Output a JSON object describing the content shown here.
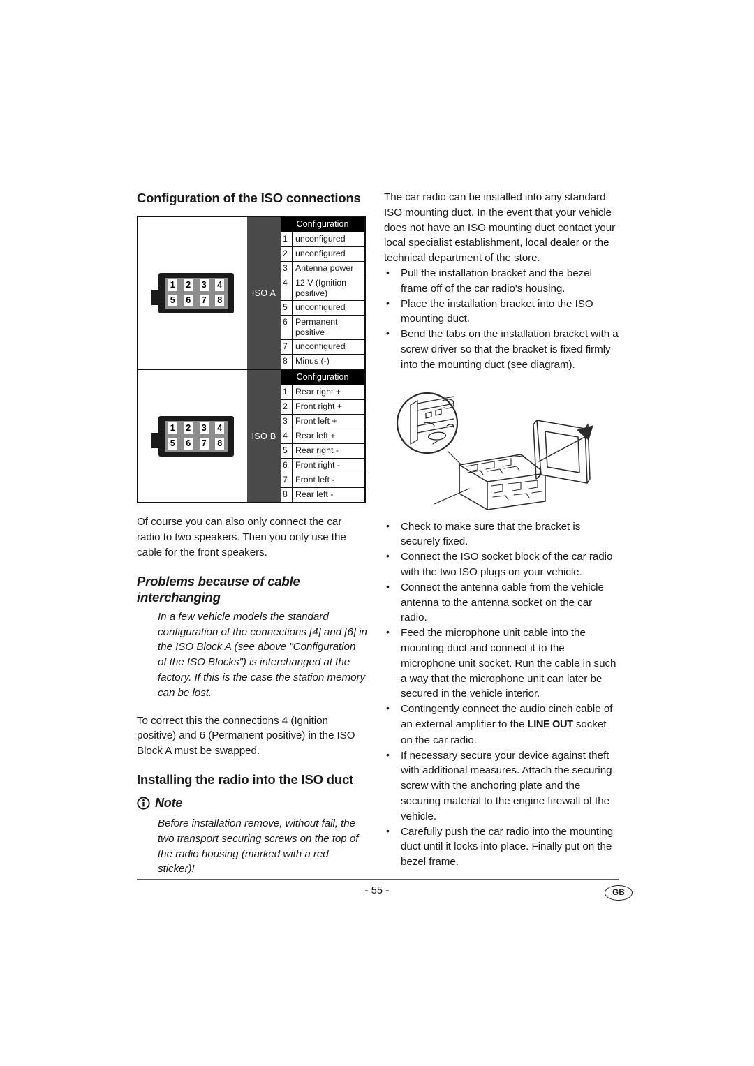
{
  "page": {
    "number_label": "- 55 -",
    "language_badge": "GB"
  },
  "left_column": {
    "heading_iso_config": "Configuration of the ISO connections",
    "iso_table": {
      "blocks": [
        {
          "block_label": "ISO A",
          "connector_pins": [
            "1",
            "2",
            "3",
            "4",
            "5",
            "6",
            "7",
            "8"
          ],
          "column_header": "Configuration",
          "rows": [
            {
              "num": "1",
              "value": "unconfigured"
            },
            {
              "num": "2",
              "value": "unconfigured"
            },
            {
              "num": "3",
              "value": "Antenna power"
            },
            {
              "num": "4",
              "value": "12 V (Ignition positive)"
            },
            {
              "num": "5",
              "value": "unconfigured"
            },
            {
              "num": "6",
              "value": "Permanent positive"
            },
            {
              "num": "7",
              "value": "unconfigured"
            },
            {
              "num": "8",
              "value": "Minus (-)"
            }
          ]
        },
        {
          "block_label": "ISO B",
          "connector_pins": [
            "1",
            "2",
            "3",
            "4",
            "5",
            "6",
            "7",
            "8"
          ],
          "column_header": "Configuration",
          "rows": [
            {
              "num": "1",
              "value": "Rear right +"
            },
            {
              "num": "2",
              "value": "Front right +"
            },
            {
              "num": "3",
              "value": "Front left +"
            },
            {
              "num": "4",
              "value": "Rear left +"
            },
            {
              "num": "5",
              "value": "Rear right -"
            },
            {
              "num": "6",
              "value": "Front right -"
            },
            {
              "num": "7",
              "value": "Front left -"
            },
            {
              "num": "8",
              "value": "Rear left -"
            }
          ]
        }
      ]
    },
    "paragraph_two_speakers": "Of course you can also only connect the car radio to two speakers. Then you only use the cable for the front speakers.",
    "heading_cable_interchanging": "Problems because of cable interchanging",
    "paragraph_interchanging": "In a few vehicle models the standard configuration of the connections [4] and [6] in the ISO Block A (see above \"Configuration of the ISO Blocks\") is interchanged at the factory. If this is the case the station memory can be lost.",
    "paragraph_correction": "To correct this the connections 4 (Ignition positive) and 6 (Permanent positive) in the ISO Block A must be swapped.",
    "heading_installing": "Installing the radio into the ISO duct",
    "note_label": "Note",
    "note_text": "Before installation remove, without fail, the two transport securing screws on the top of the radio housing (marked with a red sticker)!"
  },
  "right_column": {
    "intro_paragraph": "The car radio can be installed into any standard ISO mounting duct. In the event that your vehicle does not have an ISO mounting duct contact your local specialist establishment, local dealer or the technical department of the store.",
    "bullets_before_image": [
      "Pull the installation bracket and the bezel frame off of the car radio's housing.",
      "Place the installation bracket into the ISO mounting duct.",
      "Bend the tabs on the installation bracket with a screw driver so that the bracket is fixed firmly into the mounting duct (see diagram)."
    ],
    "bullets_after_image": [
      "Check to make sure that the bracket is securely fixed.",
      "Connect the ISO socket block of the car radio with the two ISO plugs on your vehicle.",
      "Connect the antenna cable from the vehicle antenna to the antenna socket on the car radio.",
      "Feed the microphone unit cable into the mounting duct and connect it to the microphone unit socket. Run the cable in such a way that the microphone unit can later be secured in the vehicle interior."
    ],
    "bullet_lineout": {
      "text_before": "Contingently connect the audio cinch cable of an external amplifier to the ",
      "emphasis": "LINE OUT",
      "text_after": " socket on the car radio."
    },
    "bullets_tail": [
      "If necessary secure your device against theft with additional measures. Attach the securing screw with the anchoring plate and the securing material to the engine firewall of the vehicle.",
      "Carefully push the car radio into the mounting duct until it locks into place. Finally put on the bezel frame."
    ]
  }
}
